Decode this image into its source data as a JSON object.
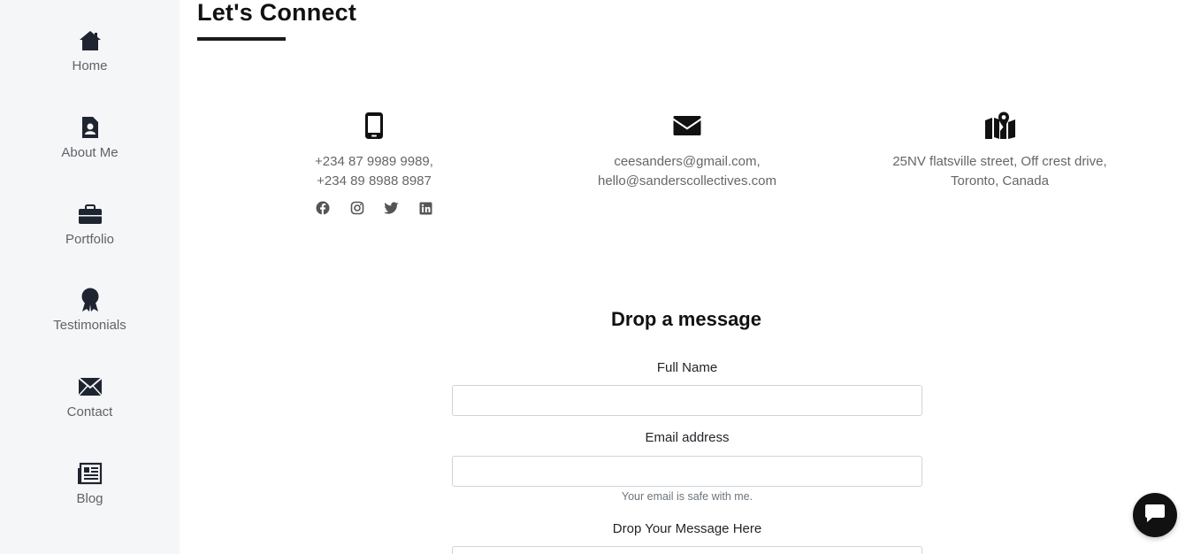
{
  "sidebar": {
    "items": [
      {
        "label": "Home",
        "icon": "home-icon"
      },
      {
        "label": "About Me",
        "icon": "id-badge-icon"
      },
      {
        "label": "Portfolio",
        "icon": "briefcase-icon"
      },
      {
        "label": "Testimonials",
        "icon": "award-icon"
      },
      {
        "label": "Contact",
        "icon": "envelope-icon"
      },
      {
        "label": "Blog",
        "icon": "newspaper-icon"
      }
    ]
  },
  "header": {
    "title": "Let's Connect"
  },
  "contact": {
    "phone": {
      "icon": "mobile-phone-icon",
      "line1": "+234 87 9989 9989,",
      "line2": "+234 89 8988 8987"
    },
    "email": {
      "icon": "envelope-icon",
      "line1": "ceesanders@gmail.com,",
      "line2": "hello@sanderscollectives.com"
    },
    "address": {
      "icon": "map-marker-icon",
      "line1": "25NV flatsville street, Off crest drive,",
      "line2": "Toronto, Canada"
    },
    "socials": [
      "facebook-icon",
      "instagram-icon",
      "twitter-icon",
      "linkedin-icon"
    ]
  },
  "form": {
    "title": "Drop a message",
    "full_name_label": "Full Name",
    "full_name_value": "",
    "email_label": "Email address",
    "email_value": "",
    "email_help": "Your email is safe with me.",
    "message_label": "Drop Your Message Here",
    "message_value": ""
  },
  "chat": {
    "icon": "chat-bubble-icon"
  },
  "colors": {
    "sidebar_bg": "#f5f6f8",
    "text_dark": "#111111",
    "text_muted": "#666666"
  }
}
